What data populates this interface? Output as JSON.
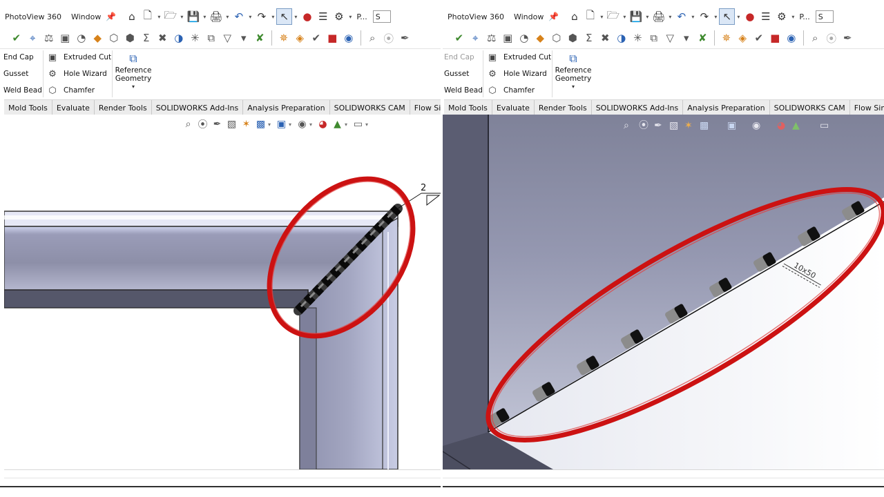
{
  "left": {
    "menu": {
      "app_title": "PhotoView 360",
      "window_label": "Window",
      "truncated": "P...",
      "box": "S"
    },
    "command_manager": {
      "col1": [
        "End Cap",
        "Gusset",
        "Weld Bead"
      ],
      "col2": [
        "Extruded Cut",
        "Hole Wizard",
        "Chamfer"
      ],
      "reference_geometry": [
        "Reference",
        "Geometry"
      ]
    },
    "tabs": [
      "Mold Tools",
      "Evaluate",
      "Render Tools",
      "SOLIDWORKS Add-Ins",
      "Analysis Preparation",
      "SOLIDWORKS CAM",
      "Flow Simulation"
    ],
    "weld_symbol_size": "2"
  },
  "right": {
    "menu": {
      "app_title": "PhotoView 360",
      "window_label": "Window",
      "truncated": "P...",
      "box": "S"
    },
    "command_manager": {
      "col1": [
        "End Cap",
        "Gusset",
        "Weld Bead"
      ],
      "col2": [
        "Extruded Cut",
        "Hole Wizard",
        "Chamfer"
      ],
      "reference_geometry": [
        "Reference",
        "Geometry"
      ]
    },
    "tabs": [
      "Mold Tools",
      "Evaluate",
      "Render Tools",
      "SOLIDWORKS Add-Ins",
      "Analysis Preparation",
      "SOLIDWORKS CAM",
      "Flow Simulation"
    ],
    "weld_annotation": "10x50"
  },
  "icons": {
    "quick_access": [
      "home-icon",
      "new-document-icon",
      "open-icon",
      "save-icon",
      "print-icon",
      "undo-icon",
      "redo-icon",
      "select-icon",
      "traffic-light-icon",
      "file-properties-icon",
      "options-gear-icon"
    ],
    "evaluate_toolbar": [
      "spelling-icon",
      "measure-icon",
      "mass-properties-icon",
      "section-properties-icon",
      "sensor-icon",
      "performance-icon",
      "interference-icon",
      "check-icon",
      "equation-icon",
      "draft-analysis-icon",
      "symmetry-icon",
      "thickness-icon",
      "zebra-icon",
      "curvature-icon",
      "deviation-icon",
      "geometry-analysis-icon",
      "compare-icon",
      "costing-icon",
      "mold-icon",
      "design-check-icon",
      "red-part-icon",
      "blue-part-icon",
      "zoom-to-fit-icon",
      "zoom-area-icon",
      "previous-view-icon"
    ],
    "heads_up": [
      "zoom-to-fit-icon",
      "zoom-area-icon",
      "previous-view-icon",
      "section-view-icon",
      "dynamic-annotation-icon",
      "view-orientation-icon",
      "display-style-icon",
      "hide-show-icon",
      "edit-appearance-icon",
      "scene-icon",
      "view-settings-icon"
    ]
  },
  "colors": {
    "highlight_ellipse": "#cc1212",
    "part_face": "#8d8fa8",
    "ribbon_bg": "#f4f4f4"
  }
}
